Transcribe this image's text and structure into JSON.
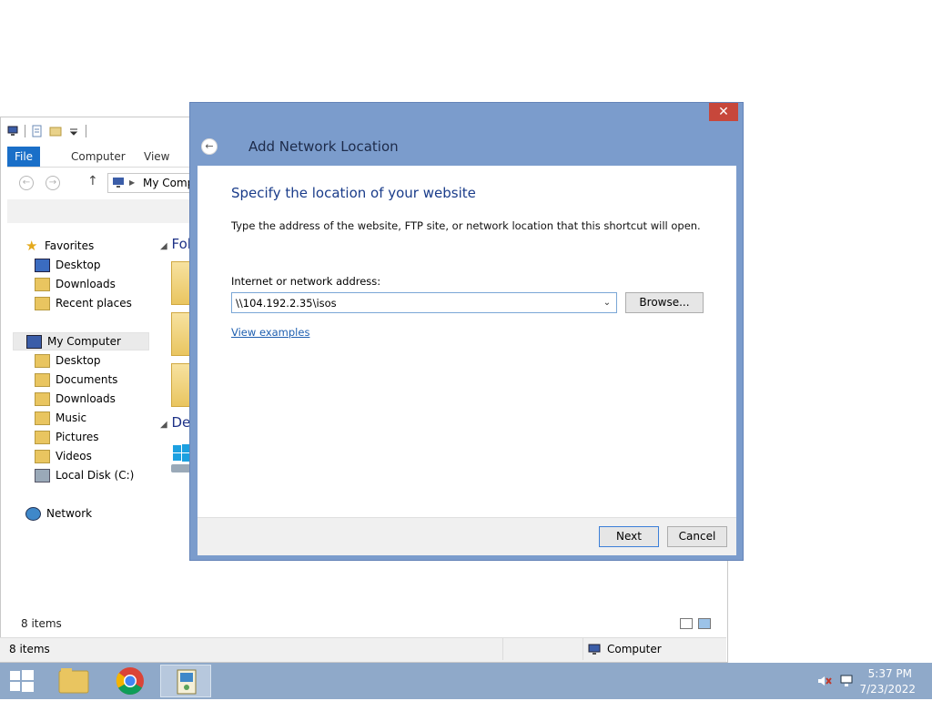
{
  "explorer": {
    "ribbon_tabs": [
      "File",
      "Computer",
      "View"
    ],
    "address_text": "My Comp",
    "nav": {
      "favorites": "Favorites",
      "fav_desktop": "Desktop",
      "fav_downloads": "Downloads",
      "fav_recent": "Recent places",
      "my_computer": "My Computer",
      "mc_desktop": "Desktop",
      "mc_documents": "Documents",
      "mc_downloads": "Downloads",
      "mc_music": "Music",
      "mc_pictures": "Pictures",
      "mc_videos": "Videos",
      "mc_localdisk": "Local Disk (C:)",
      "network": "Network"
    },
    "groups": {
      "folders_partial": "Fol",
      "devices_partial": "De"
    },
    "item_count": "8 items",
    "status": {
      "items": "8 items",
      "location": "Computer"
    }
  },
  "dialog": {
    "close_glyph": "✕",
    "title": "Add Network Location",
    "heading": "Specify the location of your website",
    "description": "Type the address of the website, FTP site, or network location that this shortcut will open.",
    "address_label": "Internet or network address:",
    "address_value": "\\\\104.192.2.35\\isos",
    "browse_label": "Browse...",
    "examples_link": "View examples",
    "next_label": "Next",
    "cancel_label": "Cancel"
  },
  "taskbar": {
    "time": "5:37 PM",
    "date": "7/23/2022"
  },
  "colors": {
    "dialog_frame": "#7b9ccc",
    "heading": "#1a3c8a",
    "file_tab": "#1a6fc8",
    "taskbar": "#8fa9c9",
    "close_button": "#c7473b"
  }
}
